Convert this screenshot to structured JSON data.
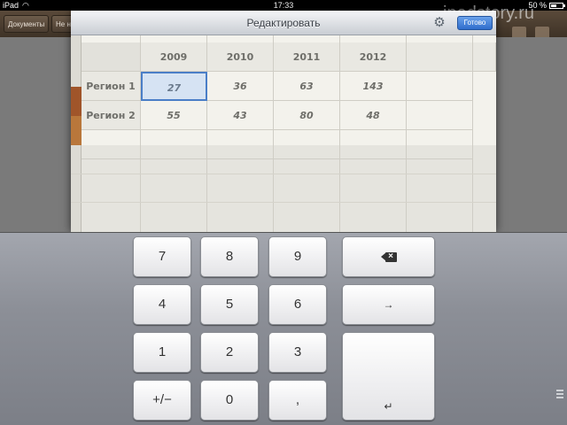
{
  "status_bar": {
    "device": "iPad",
    "time": "17:33",
    "battery_percent": "50 %",
    "battery_level": 0.5
  },
  "background_app": {
    "tabs": [
      "Документы",
      "Не н"
    ]
  },
  "editor": {
    "title": "Редактировать",
    "done_label": "Готово",
    "column_headers": [
      "2009",
      "2010",
      "2011",
      "2012"
    ],
    "rows": [
      {
        "label": "Регион 1",
        "values": [
          "27",
          "36",
          "63",
          "143"
        ],
        "swatch_color": "#a0552a"
      },
      {
        "label": "Регион 2",
        "values": [
          "55",
          "43",
          "80",
          "48"
        ],
        "swatch_color": "#b9773b"
      }
    ],
    "selected_cell": "Регион 1 / 2009"
  },
  "keyboard": {
    "keys": [
      "7",
      "8",
      "9",
      "4",
      "5",
      "6",
      "1",
      "2",
      "3",
      "+/−",
      "0",
      ","
    ],
    "backspace_icon": "backspace-icon",
    "tab_symbol": "→",
    "return_symbol": "↵"
  },
  "watermark": "ipadstory.ru",
  "colors": {
    "accent": "#2f6dcc",
    "selection": "#d6e3f3",
    "keyboard_bg": "#8c8f97"
  }
}
